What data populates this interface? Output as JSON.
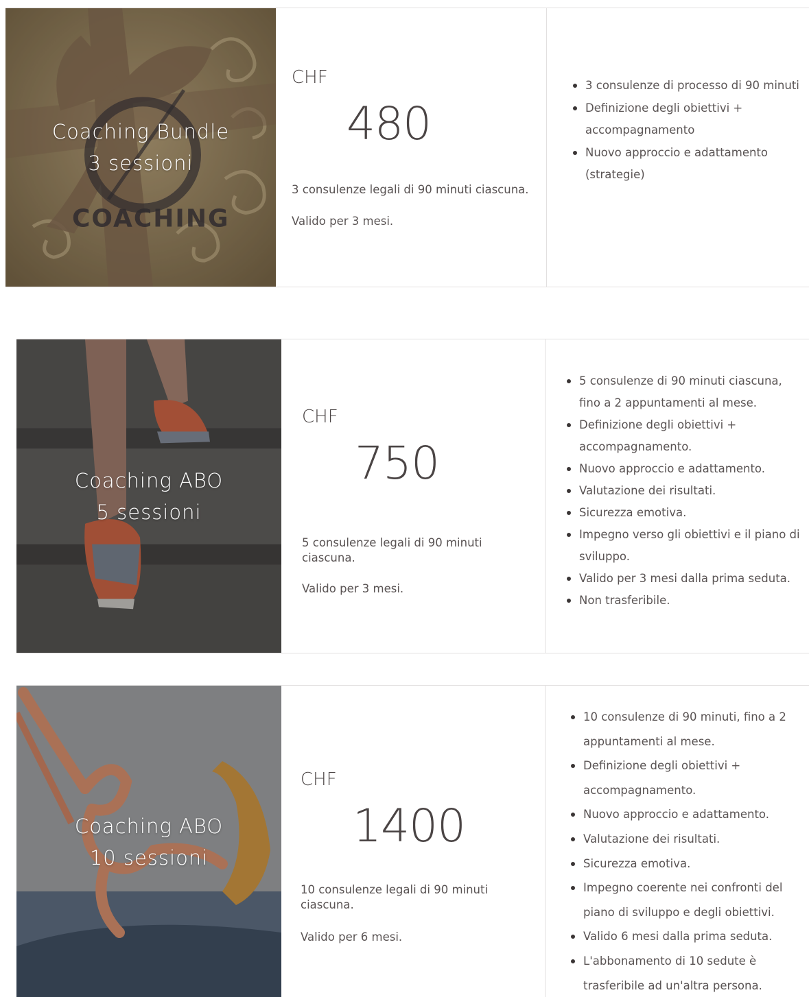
{
  "currency": "CHF",
  "packages": [
    {
      "title_line1": "Coaching Bundle",
      "title_line2": "3 sessioni",
      "logo_text": "COACHING",
      "price": "480",
      "description": "3 consulenze legali di 90 minuti ciascuna.",
      "validity": "Valido per 3 mesi.",
      "features": [
        "3 consulenze di processo di 90 minuti",
        "Definizione degli obiettivi + accompagnamento",
        "Nuovo approccio e adattamento (strategie)"
      ]
    },
    {
      "title_line1": "Coaching ABO",
      "title_line2": "5 sessioni",
      "price": "750",
      "description": "5 consulenze legali di 90 minuti ciascuna.",
      "validity": "Valido per 3 mesi.",
      "features": [
        "5 consulenze di 90 minuti ciascuna, fino a 2 appuntamenti al mese.",
        "Definizione degli obiettivi + accompagnamento.",
        "Nuovo approccio e adattamento.",
        "Valutazione dei risultati.",
        "Sicurezza emotiva.",
        "Impegno verso gli obiettivi e il piano di sviluppo.",
        "Valido per 3 mesi dalla prima seduta.",
        "Non trasferibile."
      ]
    },
    {
      "title_line1": "Coaching ABO",
      "title_line2": "10 sessioni",
      "price": "1400",
      "description": "10 consulenze legali di 90 minuti ciascuna.",
      "validity": "Valido per 6 mesi.",
      "features": [
        "10 consulenze di 90 minuti, fino a 2 appuntamenti al mese.",
        "Definizione degli obiettivi + accompagnamento.",
        "Nuovo approccio e adattamento.",
        "Valutazione dei risultati.",
        "Sicurezza emotiva.",
        "Impegno coerente nei confronti del piano di sviluppo e degli obiettivi.",
        "Valido 6 mesi dalla prima seduta.",
        "L'abbonamento di 10 sedute è trasferibile ad un'altra persona."
      ]
    }
  ]
}
